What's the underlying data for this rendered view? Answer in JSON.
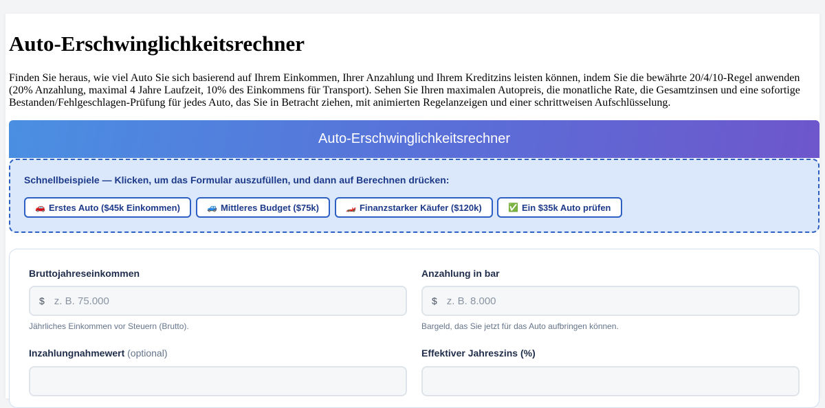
{
  "page": {
    "title": "Auto-Erschwinglichkeitsrechner",
    "intro": "Finden Sie heraus, wie viel Auto Sie sich basierend auf Ihrem Einkommen, Ihrer Anzahlung und Ihrem Kreditzins leisten können, indem Sie die bewährte 20/4/10-Regel anwenden (20% Anzahlung, maximal 4 Jahre Laufzeit, 10% des Einkommens für Transport). Sehen Sie Ihren maximalen Autopreis, die monatliche Rate, die Gesamtzinsen und eine sofortige Bestanden/Fehlgeschlagen-Prüfung für jedes Auto, das Sie in Betracht ziehen, mit animierten Regelanzeigen und einer schrittweisen Aufschlüsselung."
  },
  "calculator": {
    "header": "Auto-Erschwinglichkeitsrechner"
  },
  "examples": {
    "label": "Schnellbeispiele — Klicken, um das Formular auszufüllen, und dann auf Berechnen drücken:",
    "buttons": [
      {
        "emoji": "🚗",
        "label": "Erstes Auto ($45k Einkommen)"
      },
      {
        "emoji": "🚙",
        "label": "Mittleres Budget ($75k)"
      },
      {
        "emoji": "🏎️",
        "label": "Finanzstarker Käufer ($120k)"
      },
      {
        "emoji": "✅",
        "label": "Ein $35k Auto prüfen"
      }
    ]
  },
  "form": {
    "income": {
      "label": "Bruttojahreseinkommen",
      "prefix": "$",
      "placeholder": "z. B. 75.000",
      "value": "",
      "hint": "Jährliches Einkommen vor Steuern (Brutto)."
    },
    "down_payment": {
      "label": "Anzahlung in bar",
      "prefix": "$",
      "placeholder": "z. B. 8.000",
      "value": "",
      "hint": "Bargeld, das Sie jetzt für das Auto aufbringen können."
    },
    "trade_in": {
      "label": "Inzahlungnahmewert",
      "optional": "(optional)"
    },
    "apr": {
      "label": "Effektiver Jahreszins (%)"
    }
  },
  "colors": {
    "accent": "#2b5fc4",
    "header_gradient_start": "#4a8fe2",
    "header_gradient_end": "#6e56cc",
    "examples_background": "#dbe8fb"
  }
}
